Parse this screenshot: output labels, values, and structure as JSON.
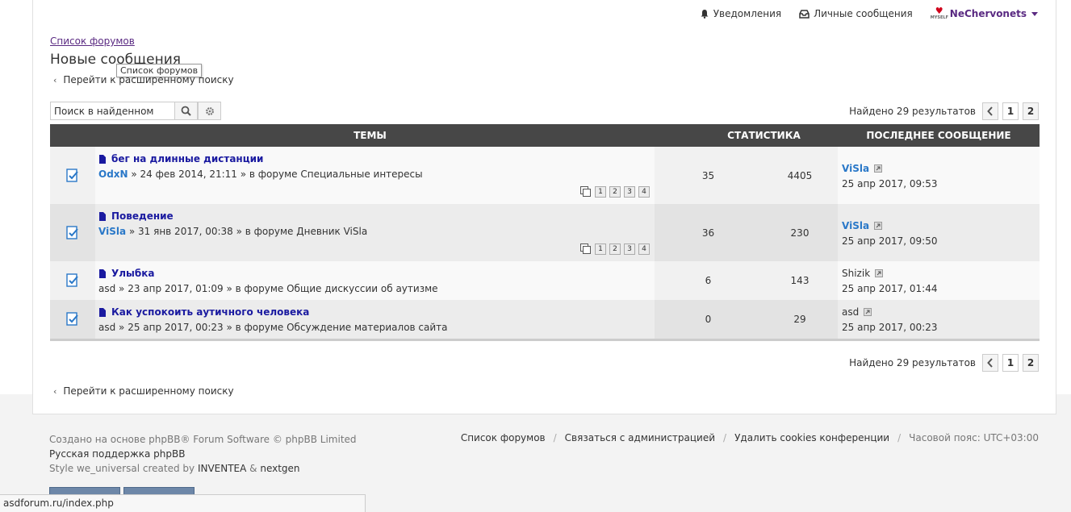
{
  "topbar": {
    "notifications": "Уведомления",
    "messages": "Личные сообщения",
    "username": "NeChervonets"
  },
  "breadcrumb": "Список форумов",
  "page_title": "Новые сообщения",
  "tooltip": "Список форумов",
  "advanced_search": "Перейти к расширенному поиску",
  "search": {
    "value": "Поиск в найденном"
  },
  "results": {
    "text": "Найдено 29 результатов",
    "pages": [
      "1",
      "2"
    ]
  },
  "headers": {
    "topics": "ТЕМЫ",
    "stats": "СТАТИСТИКА",
    "last": "ПОСЛЕДНЕЕ СООБЩЕНИЕ"
  },
  "topics": [
    {
      "title": "бег на длинные дистанции",
      "author": "OdxN",
      "meta": " » 24 фев 2014, 21:11 » в форуме Специальные интересы",
      "replies": "35",
      "views": "4405",
      "last_author": "ViSla",
      "last_date": "25 апр 2017, 09:53",
      "pages": [
        "1",
        "2",
        "3",
        "4"
      ]
    },
    {
      "title": "Поведение",
      "author": "ViSla",
      "meta": " » 31 янв 2017, 00:38 » в форуме Дневник ViSla",
      "replies": "36",
      "views": "230",
      "last_author": "ViSla",
      "last_date": "25 апр 2017, 09:50",
      "pages": [
        "1",
        "2",
        "3",
        "4"
      ]
    },
    {
      "title": "Улыбка",
      "author": "asd",
      "meta": " » 23 апр 2017, 01:09 » в форуме Общие дискуссии об аутизме",
      "replies": "6",
      "views": "143",
      "last_author": "Shizik",
      "last_date": "25 апр 2017, 01:44"
    },
    {
      "title": "Как успокоить аутичного человека",
      "author": "asd",
      "meta": " » 25 апр 2017, 00:23 » в форуме Обсуждение материалов сайта",
      "replies": "0",
      "views": "29",
      "last_author": "asd",
      "last_date": "25 апр 2017, 00:23"
    }
  ],
  "footer": {
    "line1": "Создано на основе phpBB® Forum Software © phpBB Limited",
    "line2": "Русская поддержка phpBB",
    "line3a": "Style we_universal created by ",
    "line3b": "INVENTEA",
    "line3c": " & ",
    "line3d": "nextgen",
    "links": [
      "Список форумов",
      "Связаться с администрацией",
      "Удалить cookies конференции"
    ],
    "timezone": "Часовой пояс: UTC+03:00"
  },
  "status_url": "asdforum.ru/index.php",
  "colors": {
    "header_bg": "#474747",
    "accent": "#5a2a82",
    "link_blue": "#2a78c8",
    "topic_blue": "#1a1aa0"
  }
}
